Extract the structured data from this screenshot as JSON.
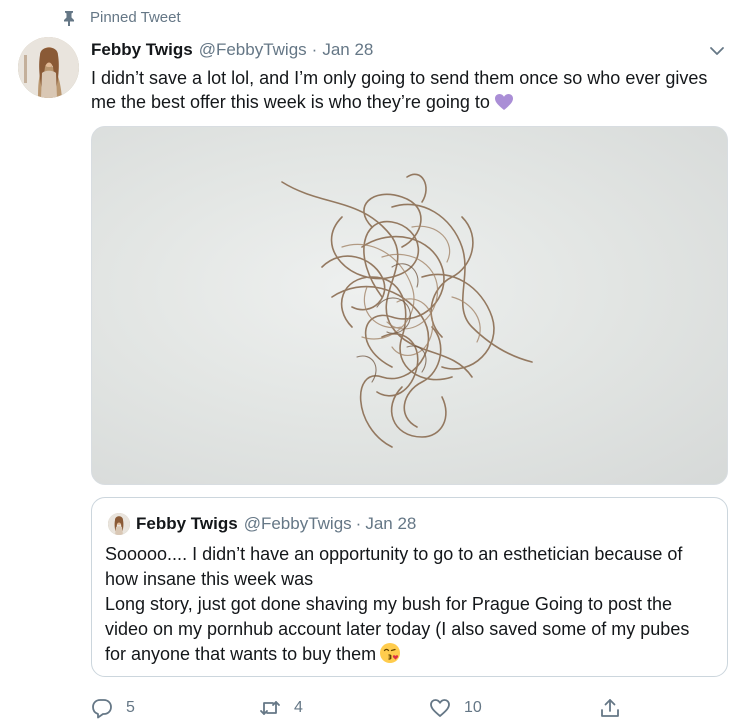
{
  "pinned": {
    "label": "Pinned Tweet",
    "icon": "pin-icon"
  },
  "tweet": {
    "author_name": "Febby Twigs",
    "author_handle": "@FebbyTwigs",
    "separator": "·",
    "date": "Jan 28",
    "text": "I didn’t save a lot lol, and I’m only going to send them once so who ever gives me the best offer this week is who they’re going to",
    "emoji": "purple-heart",
    "menu_icon": "chevron-down-icon"
  },
  "quoted_tweet": {
    "author_name": "Febby Twigs",
    "author_handle": "@FebbyTwigs",
    "separator": "·",
    "date": "Jan 28",
    "lines": [
      "Sooooo.... I didn’t have an opportunity to go to an esthetician because of",
      "how insane this week was",
      "Long story, just got done shaving my  bush for Prague Going to post the",
      "video on my pornhub account later today (I also saved some of my pubes",
      "for anyone that wants to buy them"
    ],
    "emoji": "kissing-face"
  },
  "actions": {
    "reply_count": "5",
    "retweet_count": "4",
    "like_count": "10"
  },
  "colors": {
    "text": "#14171a",
    "muted": "#657786",
    "border": "#ccd6dd",
    "heart": "#aa8ed6"
  }
}
